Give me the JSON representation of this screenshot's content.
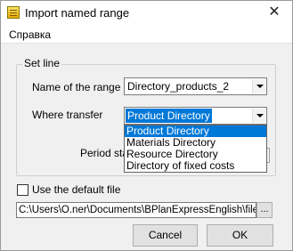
{
  "window": {
    "title": "Import named range",
    "close_glyph": "✕",
    "icon": "app-icon"
  },
  "menu": {
    "items": [
      {
        "label": "Справка"
      }
    ]
  },
  "group": {
    "title": "Set line",
    "range_label": "Name of the range",
    "range_value": "Directory_products_2",
    "transfer_label": "Where transfer",
    "transfer_value": "Product Directory",
    "transfer_options": [
      "Product Directory",
      "Materials Directory",
      "Resource Directory",
      "Directory of fixed costs"
    ],
    "transfer_selected_index": 0
  },
  "period": {
    "label": "Period sta"
  },
  "default_file": {
    "label": "Use the default file",
    "checked": false
  },
  "file_path": {
    "value": "C:\\Users\\O.ner\\Documents\\BPlanExpressEnglish\\files\\Dem",
    "browse_label": "..."
  },
  "buttons": {
    "cancel": "Cancel",
    "ok": "OK"
  },
  "colors": {
    "selection": "#0078d7",
    "window_bg": "#f0f0f0"
  }
}
